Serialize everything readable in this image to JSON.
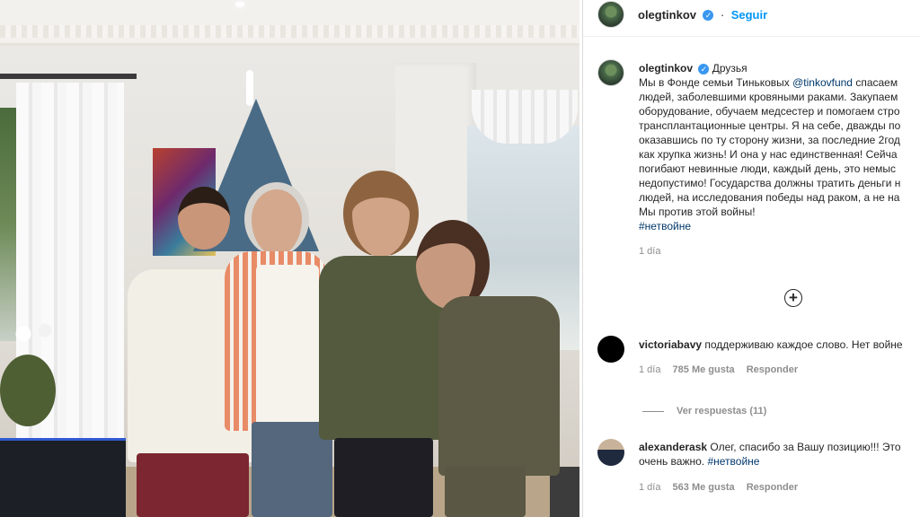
{
  "post": {
    "owner": "olegtinkov",
    "follow_label": "Seguir",
    "caption": {
      "username": "olegtinkov",
      "tag": "Друзья",
      "lines": [
        "Мы в Фонде семьи Тиньковых ",
        "людей, заболевшими кровяными раками. Закупаем",
        "оборудование, обучаем медсестер и помогаем стро",
        "трансплантационные центры. Я на себе, дважды по",
        "оказавшись по ту сторону жизни, за последние 2год",
        "как хрупка жизнь! И она у нас единственная! Сейча",
        "погибают невинные люди, каждый день, это немыс",
        "недопустимо! Государства должны тратить деньги н",
        "людей, на исследования победы над раком, а не на",
        "Мы против этой войны!"
      ],
      "mention": "@tinkovfund",
      "after_mention": " спасаем",
      "hashtag": "#нетвойне",
      "time": "1 día"
    },
    "load_more_icon": "plus-circle-icon"
  },
  "comments": [
    {
      "username": "victoriabavy",
      "text": "поддерживаю каждое слово. Нет войне",
      "time": "1 día",
      "likes": "785 Me gusta",
      "reply": "Responder",
      "view_replies": "Ver respuestas (11)"
    },
    {
      "username": "alexanderask",
      "text_line1": "Олег, спасибо за Вашу позицию!!! Это",
      "text_line2": "очень важно. ",
      "hashtag": "#нетвойне",
      "time": "1 día",
      "likes": "563 Me gusta",
      "reply": "Responder"
    }
  ]
}
